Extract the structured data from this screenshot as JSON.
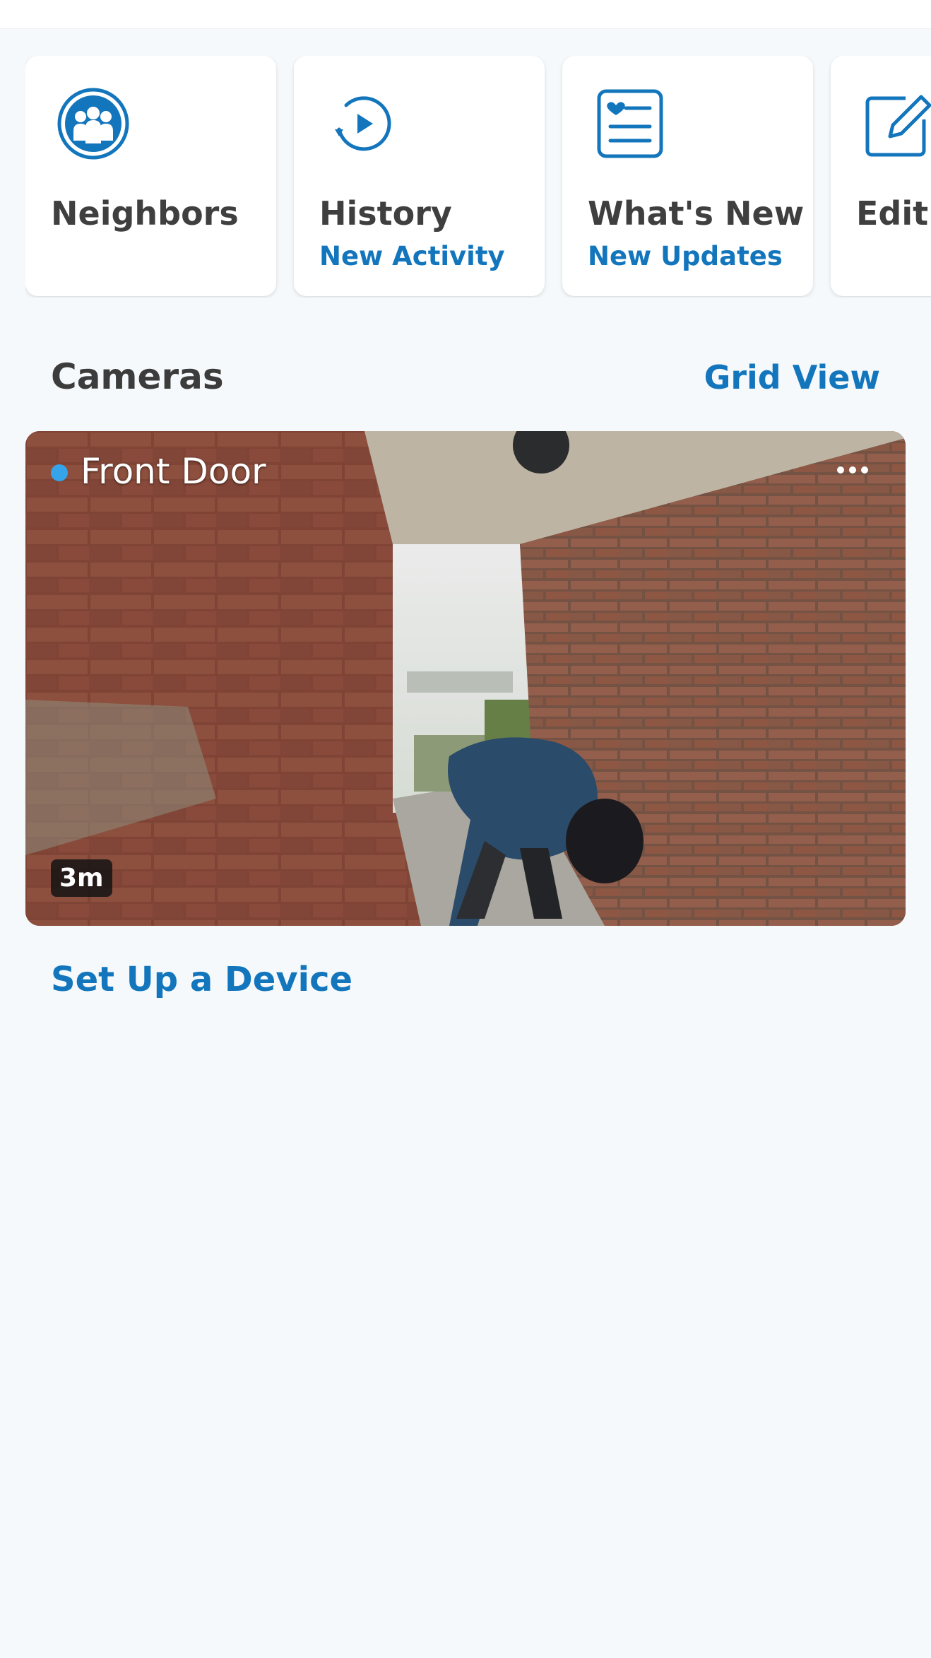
{
  "tiles": [
    {
      "label": "Neighbors",
      "sub": "",
      "icon": "neighbors-icon"
    },
    {
      "label": "History",
      "sub": "New Activity",
      "icon": "history-icon"
    },
    {
      "label": "What's New",
      "sub": "New Updates",
      "icon": "whats-new-icon"
    },
    {
      "label": "Edit",
      "sub": "",
      "icon": "edit-icon"
    }
  ],
  "cameras": {
    "title": "Cameras",
    "grid_view_label": "Grid View",
    "items": [
      {
        "name": "Front Door",
        "status_color": "#35a4e8",
        "time_ago": "3m",
        "more_icon": "more-horizontal-icon"
      }
    ]
  },
  "setup_label": "Set Up a Device",
  "colors": {
    "accent": "#1376bd",
    "status_online": "#35a4e8",
    "background": "#f6f9fb"
  }
}
